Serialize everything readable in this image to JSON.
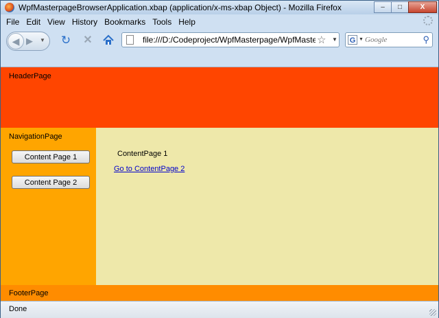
{
  "window": {
    "title": "WpfMasterpageBrowserApplication.xbap (application/x-ms-xbap Object) - Mozilla Firefox",
    "minimize_label": "–",
    "maximize_label": "□",
    "close_label": "X"
  },
  "menubar": {
    "items": [
      "File",
      "Edit",
      "View",
      "History",
      "Bookmarks",
      "Tools",
      "Help"
    ]
  },
  "toolbar": {
    "url": "file:///D:/Codeproject/WpfMasterpage/WpfMasterpage",
    "search_placeholder": "Google",
    "search_engine": "G"
  },
  "page": {
    "header_label": "HeaderPage",
    "navigation_label": "NavigationPage",
    "nav_buttons": [
      "Content Page 1",
      "Content Page 2"
    ],
    "content_title": "ContentPage 1",
    "content_link": "Go to ContentPage 2",
    "footer_label": "FooterPage",
    "colors": {
      "header": "#ff4500",
      "navigation": "#ffa500",
      "content": "#eee8aa",
      "footer": "#ff8c00"
    }
  },
  "status": {
    "text": "Done"
  }
}
